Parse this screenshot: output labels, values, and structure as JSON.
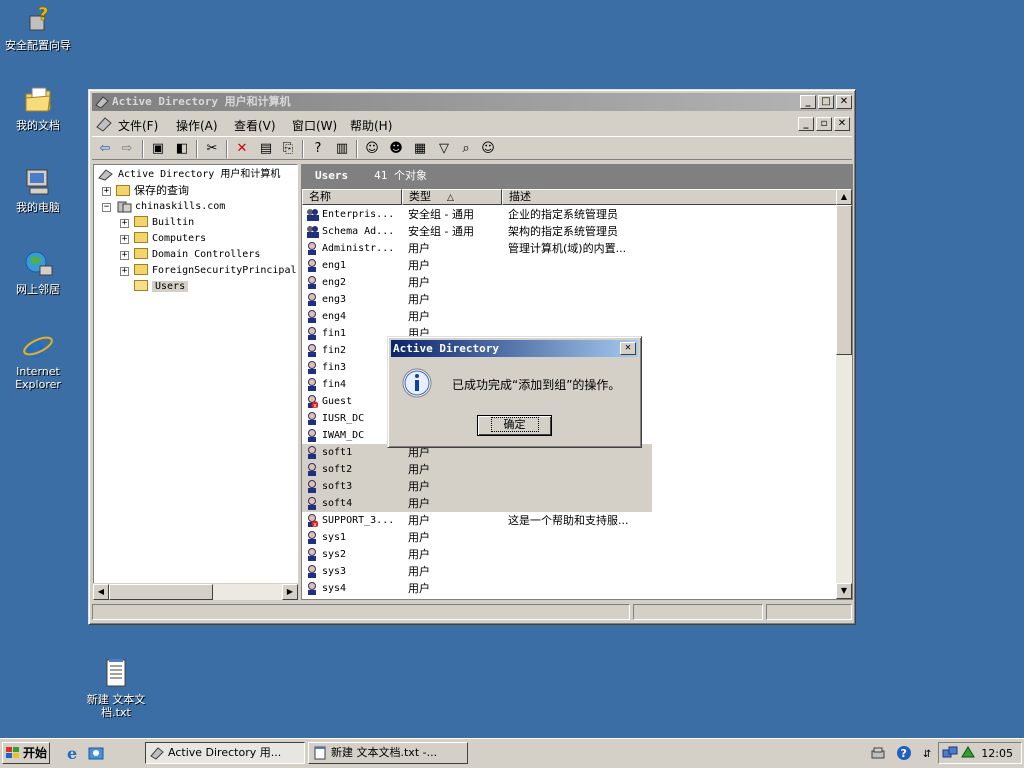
{
  "desktop": {
    "icons": [
      {
        "label": "安全配置向导"
      },
      {
        "label": "我的文档"
      },
      {
        "label": "我的电脑"
      },
      {
        "label": "网上邻居"
      },
      {
        "label": "Internet Explorer"
      },
      {
        "label": "新建 文本文档.txt"
      }
    ]
  },
  "window": {
    "title": "Active Directory 用户和计算机",
    "menu": [
      "文件(F)",
      "操作(A)",
      "查看(V)",
      "窗口(W)",
      "帮助(H)"
    ],
    "tree": {
      "root": "Active Directory 用户和计算机",
      "saved_queries": "保存的查询",
      "domain": "chinaskills.com",
      "children": [
        "Builtin",
        "Computers",
        "Domain Controllers",
        "ForeignSecurityPrincipal",
        "Users"
      ]
    },
    "list_header": {
      "title": "Users",
      "count": "41 个对象"
    },
    "columns": [
      "名称",
      "类型",
      "描述"
    ],
    "rows": [
      {
        "name": "Enterpris...",
        "type": "安全组 - 通用",
        "desc": "企业的指定系统管理员",
        "icon": "group-icon"
      },
      {
        "name": "Schema Ad...",
        "type": "安全组 - 通用",
        "desc": "架构的指定系统管理员",
        "icon": "group-icon"
      },
      {
        "name": "Administr...",
        "type": "用户",
        "desc": "管理计算机(域)的内置...",
        "icon": "user-icon"
      },
      {
        "name": "eng1",
        "type": "用户",
        "desc": "",
        "icon": "user-icon"
      },
      {
        "name": "eng2",
        "type": "用户",
        "desc": "",
        "icon": "user-icon"
      },
      {
        "name": "eng3",
        "type": "用户",
        "desc": "",
        "icon": "user-icon"
      },
      {
        "name": "eng4",
        "type": "用户",
        "desc": "",
        "icon": "user-icon"
      },
      {
        "name": "fin1",
        "type": "用户",
        "desc": "",
        "icon": "user-icon"
      },
      {
        "name": "fin2",
        "type": "",
        "desc": "",
        "icon": "user-icon"
      },
      {
        "name": "fin3",
        "type": "",
        "desc": "",
        "icon": "user-icon"
      },
      {
        "name": "fin4",
        "type": "",
        "desc": "",
        "icon": "user-icon"
      },
      {
        "name": "Guest",
        "type": "",
        "desc": "",
        "icon": "disabled-user-icon"
      },
      {
        "name": "IUSR_DC",
        "type": "",
        "desc": "",
        "icon": "user-icon"
      },
      {
        "name": "IWAM_DC",
        "type": "",
        "desc": "",
        "icon": "user-icon"
      },
      {
        "name": "soft1",
        "type": "用户",
        "desc": "",
        "icon": "user-icon"
      },
      {
        "name": "soft2",
        "type": "用户",
        "desc": "",
        "icon": "user-icon"
      },
      {
        "name": "soft3",
        "type": "用户",
        "desc": "",
        "icon": "user-icon"
      },
      {
        "name": "soft4",
        "type": "用户",
        "desc": "",
        "icon": "user-icon"
      },
      {
        "name": "SUPPORT_3...",
        "type": "用户",
        "desc": "这是一个帮助和支持服...",
        "icon": "disabled-user-icon"
      },
      {
        "name": "sys1",
        "type": "用户",
        "desc": "",
        "icon": "user-icon"
      },
      {
        "name": "sys2",
        "type": "用户",
        "desc": "",
        "icon": "user-icon"
      },
      {
        "name": "sys3",
        "type": "用户",
        "desc": "",
        "icon": "user-icon"
      },
      {
        "name": "sys4",
        "type": "用户",
        "desc": "",
        "icon": "user-icon"
      }
    ]
  },
  "dialog": {
    "title": "Active Directory",
    "message": "已成功完成“添加到组”的操作。",
    "ok_label": "确定"
  },
  "taskbar": {
    "start_label": "开始",
    "tasks": [
      "Active Directory 用...",
      "新建 文本文档.txt -..."
    ],
    "clock": "12:05"
  }
}
